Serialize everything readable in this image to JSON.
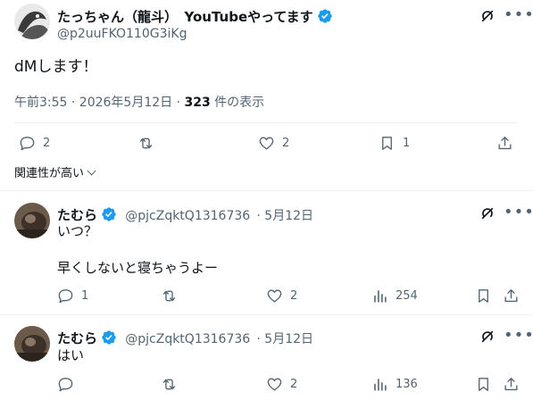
{
  "main_tweet": {
    "author_name": "たっちゃん（龍斗）　YouTubeやってます",
    "handle": "@p2uuFKO110G3iKg",
    "text": "dMします！",
    "time": "午前3:55 · 2026年5月12日 · ",
    "views_count": "323",
    "views_label": " 件の表示",
    "replies": "2",
    "likes": "2",
    "bookmarks": "1"
  },
  "sort": {
    "label": "関連性が高い"
  },
  "replies": [
    {
      "author_name": "たむら",
      "handle": "@pjcZqktQ1316736",
      "date": "· 5月12日",
      "line1": "いつ？",
      "line2": "早くしないと寝ちゃうよー",
      "replies": "1",
      "likes": "2",
      "views": "254"
    },
    {
      "author_name": "たむら",
      "handle": "@pjcZqktQ1316736",
      "date": "· 5月12日",
      "line1": "はい",
      "likes": "2",
      "views": "136"
    }
  ],
  "colors": {
    "verified": "#1d9bf0",
    "muted": "#536471",
    "divider": "#eff3f4"
  }
}
